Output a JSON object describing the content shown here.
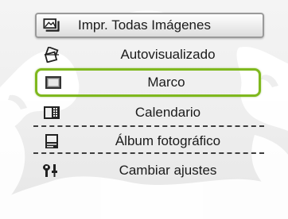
{
  "menu": {
    "items": [
      {
        "label": "Impr. Todas Imágenes",
        "icon": "print-all-images-icon",
        "state": "header"
      },
      {
        "label": "Autovisualizado",
        "icon": "slideshow-icon",
        "state": "normal"
      },
      {
        "label": "Marco",
        "icon": "frame-icon",
        "state": "selected"
      },
      {
        "label": "Calendario",
        "icon": "calendar-icon",
        "state": "normal"
      },
      {
        "label": "Álbum fotográfico",
        "icon": "photo-album-icon",
        "state": "normal"
      },
      {
        "label": "Cambiar ajustes",
        "icon": "settings-icon",
        "state": "normal"
      }
    ]
  },
  "colors": {
    "selection": "#7fb81e",
    "text": "#1b1b1b",
    "separator": "#3d3d3d",
    "background": "#eeeeee",
    "tree_silhouette": "#ffffff"
  }
}
